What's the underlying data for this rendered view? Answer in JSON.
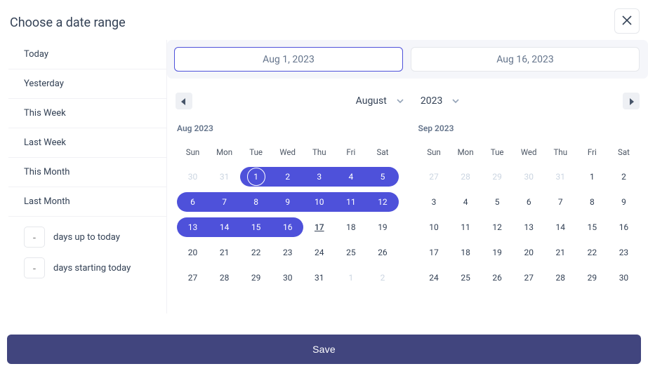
{
  "title": "Choose a date range",
  "start_date_display": "Aug 1, 2023",
  "end_date_display": "Aug 16, 2023",
  "presets": [
    {
      "label": "Today"
    },
    {
      "label": "Yesterday"
    },
    {
      "label": "This Week"
    },
    {
      "label": "Last Week"
    },
    {
      "label": "This Month"
    },
    {
      "label": "Last Month"
    }
  ],
  "days_presets": [
    {
      "placeholder": "-",
      "label": "days up to today"
    },
    {
      "placeholder": "-",
      "label": "days starting today"
    }
  ],
  "nav": {
    "month": "August",
    "year": "2023"
  },
  "weekday_headers": [
    "Sun",
    "Mon",
    "Tue",
    "Wed",
    "Thu",
    "Fri",
    "Sat"
  ],
  "calendars": [
    {
      "label": "Aug 2023",
      "weeks": [
        [
          {
            "d": "30",
            "muted": true
          },
          {
            "d": "31",
            "muted": true
          },
          {
            "d": "1",
            "in": true,
            "start": true,
            "is_start": true
          },
          {
            "d": "2",
            "in": true
          },
          {
            "d": "3",
            "in": true
          },
          {
            "d": "4",
            "in": true
          },
          {
            "d": "5",
            "in": true,
            "end": true
          }
        ],
        [
          {
            "d": "6",
            "in": true,
            "start": true
          },
          {
            "d": "7",
            "in": true
          },
          {
            "d": "8",
            "in": true
          },
          {
            "d": "9",
            "in": true
          },
          {
            "d": "10",
            "in": true
          },
          {
            "d": "11",
            "in": true
          },
          {
            "d": "12",
            "in": true,
            "end": true
          }
        ],
        [
          {
            "d": "13",
            "in": true,
            "start": true
          },
          {
            "d": "14",
            "in": true
          },
          {
            "d": "15",
            "in": true
          },
          {
            "d": "16",
            "in": true,
            "end": true
          },
          {
            "d": "17",
            "today": true
          },
          {
            "d": "18"
          },
          {
            "d": "19"
          }
        ],
        [
          {
            "d": "20"
          },
          {
            "d": "21"
          },
          {
            "d": "22"
          },
          {
            "d": "23"
          },
          {
            "d": "24"
          },
          {
            "d": "25"
          },
          {
            "d": "26"
          }
        ],
        [
          {
            "d": "27"
          },
          {
            "d": "28"
          },
          {
            "d": "29"
          },
          {
            "d": "30"
          },
          {
            "d": "31"
          },
          {
            "d": "1",
            "muted": true
          },
          {
            "d": "2",
            "muted": true
          }
        ]
      ]
    },
    {
      "label": "Sep 2023",
      "weeks": [
        [
          {
            "d": "27",
            "muted": true
          },
          {
            "d": "28",
            "muted": true
          },
          {
            "d": "29",
            "muted": true
          },
          {
            "d": "30",
            "muted": true
          },
          {
            "d": "31",
            "muted": true
          },
          {
            "d": "1"
          },
          {
            "d": "2"
          }
        ],
        [
          {
            "d": "3"
          },
          {
            "d": "4"
          },
          {
            "d": "5"
          },
          {
            "d": "6"
          },
          {
            "d": "7"
          },
          {
            "d": "8"
          },
          {
            "d": "9"
          }
        ],
        [
          {
            "d": "10"
          },
          {
            "d": "11"
          },
          {
            "d": "12"
          },
          {
            "d": "13"
          },
          {
            "d": "14"
          },
          {
            "d": "15"
          },
          {
            "d": "16"
          }
        ],
        [
          {
            "d": "17"
          },
          {
            "d": "18"
          },
          {
            "d": "19"
          },
          {
            "d": "20"
          },
          {
            "d": "21"
          },
          {
            "d": "22"
          },
          {
            "d": "23"
          }
        ],
        [
          {
            "d": "24"
          },
          {
            "d": "25"
          },
          {
            "d": "26"
          },
          {
            "d": "27"
          },
          {
            "d": "28"
          },
          {
            "d": "29"
          },
          {
            "d": "30"
          }
        ]
      ]
    }
  ],
  "save_label": "Save"
}
